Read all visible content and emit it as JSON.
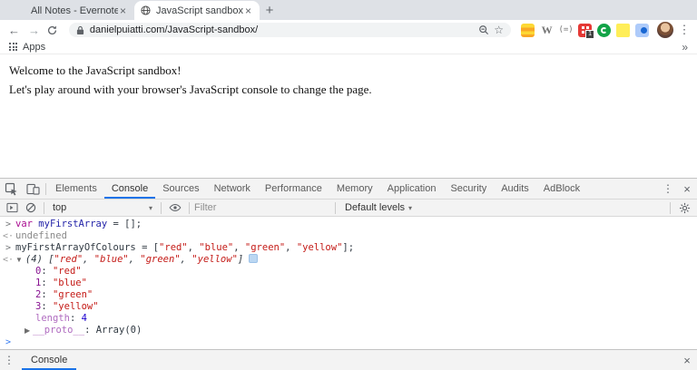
{
  "browser": {
    "tabs": [
      {
        "title": "All Notes - Evernote",
        "icon": "evernote"
      },
      {
        "title": "JavaScript sandbox",
        "icon": "globe"
      }
    ],
    "active_tab": "JavaScript sandbox",
    "url": "danielpuiatti.com/JavaScript-sandbox/",
    "bookmarks": {
      "apps_label": "Apps"
    },
    "extensions": {
      "adblock_badge": "1"
    }
  },
  "page": {
    "line1": "Welcome to the JavaScript sandbox!",
    "line2": "Let's play around with your browser's JavaScript console to change the page."
  },
  "devtools": {
    "tabs": [
      "Elements",
      "Console",
      "Sources",
      "Network",
      "Performance",
      "Memory",
      "Application",
      "Security",
      "Audits",
      "AdBlock"
    ],
    "active_tab": "Console",
    "toolbar": {
      "context": "top",
      "filter_placeholder": "Filter",
      "levels_label": "Default levels"
    },
    "console": {
      "rows": [
        {
          "type": "input",
          "segs": [
            [
              "var ",
              "kw"
            ],
            [
              "myFirstArray",
              "def"
            ],
            [
              " = [];",
              "plain"
            ]
          ]
        },
        {
          "type": "output",
          "segs": [
            [
              "undefined",
              "dim"
            ]
          ]
        },
        {
          "type": "input",
          "segs": [
            [
              "myFirstArrayOfColours = [",
              "plain"
            ],
            [
              "\"red\"",
              "str"
            ],
            [
              ", ",
              "plain"
            ],
            [
              "\"blue\"",
              "str"
            ],
            [
              ", ",
              "plain"
            ],
            [
              "\"green\"",
              "str"
            ],
            [
              ", ",
              "plain"
            ],
            [
              "\"yellow\"",
              "str"
            ],
            [
              "];",
              "plain"
            ]
          ]
        },
        {
          "type": "output",
          "italic": true,
          "expander": "open",
          "badge": true,
          "segs": [
            [
              "(4) [",
              "plain"
            ],
            [
              "\"red\"",
              "str"
            ],
            [
              ", ",
              "plain"
            ],
            [
              "\"blue\"",
              "str"
            ],
            [
              ", ",
              "plain"
            ],
            [
              "\"green\"",
              "str"
            ],
            [
              ", ",
              "plain"
            ],
            [
              "\"yellow\"",
              "str"
            ],
            [
              "]",
              "plain"
            ]
          ]
        },
        {
          "type": "child",
          "segs": [
            [
              "0",
              "prop"
            ],
            [
              ": ",
              "plain"
            ],
            [
              "\"red\"",
              "str"
            ]
          ]
        },
        {
          "type": "child",
          "segs": [
            [
              "1",
              "prop"
            ],
            [
              ": ",
              "plain"
            ],
            [
              "\"blue\"",
              "str"
            ]
          ]
        },
        {
          "type": "child",
          "segs": [
            [
              "2",
              "prop"
            ],
            [
              ": ",
              "plain"
            ],
            [
              "\"green\"",
              "str"
            ]
          ]
        },
        {
          "type": "child",
          "segs": [
            [
              "3",
              "prop"
            ],
            [
              ": ",
              "plain"
            ],
            [
              "\"yellow\"",
              "str"
            ]
          ]
        },
        {
          "type": "child",
          "segs": [
            [
              "length",
              "dimprop"
            ],
            [
              ": ",
              "plain"
            ],
            [
              "4",
              "num"
            ]
          ]
        },
        {
          "type": "child-expandable",
          "expander": "closed",
          "segs": [
            [
              "__proto__",
              "dimprop"
            ],
            [
              ": ",
              "plain"
            ],
            [
              "Array(0)",
              "plain"
            ]
          ]
        },
        {
          "type": "prompt",
          "segs": []
        }
      ]
    },
    "drawer": {
      "label": "Console"
    }
  },
  "icons": {
    "close": "×",
    "plus": "+",
    "back": "←",
    "forward": "→",
    "overflow": "»",
    "kebab": "⋮",
    "star": "☆",
    "caret": "▾",
    "input_marker": ">",
    "output_marker": "<·",
    "prompt_marker": ">",
    "expander_open": "▼",
    "expander_closed": "▶",
    "w_extension_glyph": "W",
    "code_extension_glyph": "(=)"
  },
  "colors": {
    "accent_blue": "#1a73e8",
    "tabstrip_bg": "#dee1e6",
    "devtools_bg": "#f3f3f3",
    "string_red": "#c41a16",
    "number_blue": "#1c00cf",
    "property_violet": "#881391",
    "keyword_purple": "#aa0d91",
    "evernote_green": "#2dbe60",
    "adblock_red": "#e53935"
  }
}
